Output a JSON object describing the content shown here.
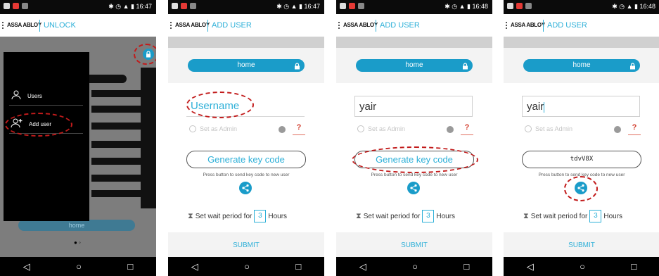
{
  "status_bar": {
    "icons": "✱ ◷ ▲ ▮",
    "times": [
      "16:47",
      "16:47",
      "16:48",
      "16:48"
    ]
  },
  "app": {
    "brand": "ASSA ABLOY",
    "titles": [
      "UNLOCK",
      "ADD USER",
      "ADD USER",
      "ADD USER"
    ]
  },
  "drawer": {
    "items": [
      "Users",
      "Add user"
    ],
    "home_faded": "home"
  },
  "form": {
    "lock_label": "home",
    "username_placeholder": "Username",
    "username_value": "yair",
    "admin_label": "Set as Admin",
    "help_label": "?",
    "generate_label": "Generate key code",
    "key_code": "tdvV8X",
    "press_hint": "Press button to send key code to new user",
    "wait_prefix": "Set wait period for",
    "wait_value": "3",
    "wait_unit": "Hours",
    "submit_label": "SUBMIT"
  },
  "nav": {
    "back": "◁",
    "home": "○",
    "recent": "□"
  },
  "colors": {
    "accent": "#2eb0d8",
    "lock_pill": "#1a9cc9",
    "annotation": "#c21b1b"
  }
}
